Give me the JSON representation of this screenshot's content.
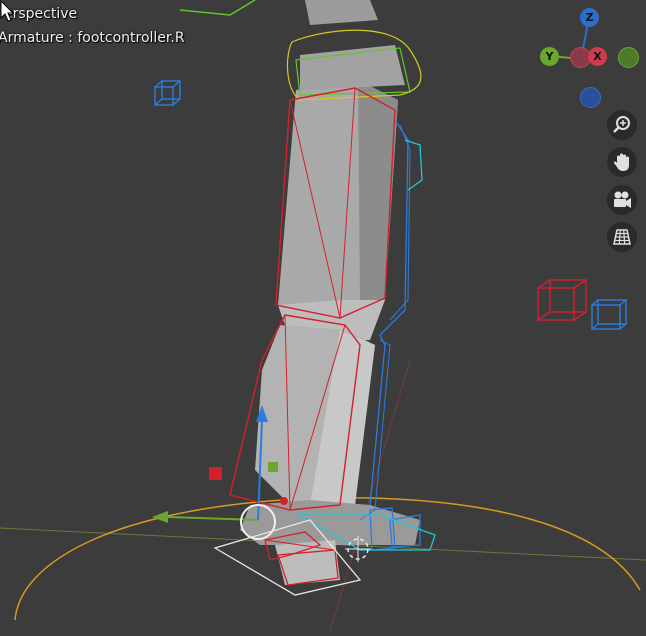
{
  "viewport": {
    "view_label": "erspective",
    "object_label": "Armature : footcontroller.R"
  },
  "gizmo": {
    "z_label": "Z",
    "y_label": "Y",
    "x_label": "X",
    "colors": {
      "x": "#d03a4c",
      "y": "#6aa82c",
      "z": "#2a6fcb"
    }
  },
  "nav_buttons": [
    {
      "icon": "zoom-icon"
    },
    {
      "icon": "hand-pan-icon"
    },
    {
      "icon": "camera-icon"
    },
    {
      "icon": "perspective-grid-icon"
    }
  ],
  "colors": {
    "background": "#3c3c3c",
    "bone_selected": "#d4202c",
    "bone_other": "#2a7de0",
    "bone_cyan": "#1ec8d8",
    "bone_green": "#5ec82a",
    "bone_yellow": "#d8c820",
    "mesh": "#b8b8b8",
    "floor_line": "#d89a20"
  }
}
